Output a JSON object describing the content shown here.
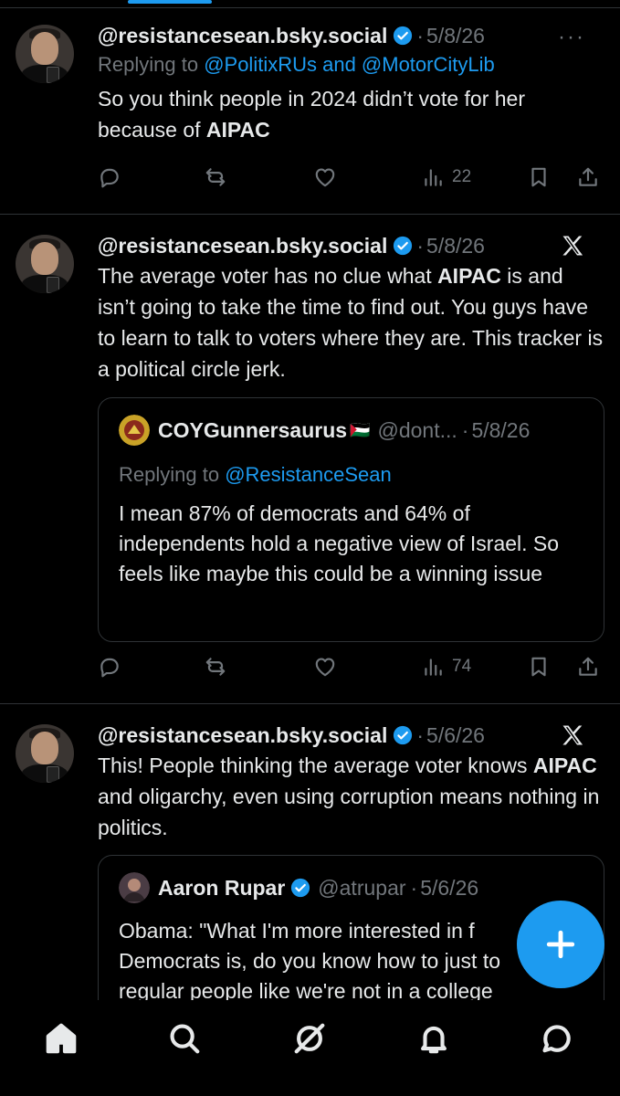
{
  "posts": [
    {
      "handle": "@resistancesean.bsky.social",
      "dot": "·",
      "date": "5/8/26",
      "more": "···",
      "replying_prefix": "Replying to ",
      "replying_handles": "@PolitixRUs and @MotorCityLib",
      "text_1": "So you think people in 2024 didn’t vote for her because of ",
      "text_bold": "AIPAC",
      "views": "22"
    },
    {
      "handle": "@resistancesean.bsky.social",
      "dot": "·",
      "date": "5/8/26",
      "text_1": "The average voter has no clue what ",
      "text_bold": "AIPAC",
      "text_2": " is and isn’t going to take the time to find out. You guys have to learn to talk to voters where they are. This tracker is a political circle jerk.",
      "quote": {
        "name": "COYGunnersaurus",
        "flag": "🇵🇸",
        "handle": "@dont...",
        "dot": "·",
        "date": "5/8/26",
        "replying_prefix": "Replying to ",
        "replying_handle": "@ResistanceSean",
        "text": "I mean 87% of democrats and 64% of independents hold a negative view of Israel. So feels like maybe this could be a winning issue"
      },
      "views": "74"
    },
    {
      "handle": "@resistancesean.bsky.social",
      "dot": "·",
      "date": "5/6/26",
      "text_1": "This! People thinking the average voter knows ",
      "text_bold": "AIPAC",
      "text_2": " and oligarchy, even using corruption means nothing in politics.",
      "quote": {
        "name": "Aaron Rupar",
        "handle": "@atrupar",
        "dot": "·",
        "date": "5/6/26",
        "text": "Obama: \"What I'm more interested in f Democrats is, do you know how to just to regular people like we're not in a college"
      }
    }
  ],
  "colors": {
    "accent": "#1d9bf0",
    "muted": "#71767b",
    "text": "#e7e9ea",
    "background": "#000000"
  },
  "icons": [
    "reply-icon",
    "repost-icon",
    "like-icon",
    "views-icon",
    "bookmark-icon",
    "share-icon",
    "x-logo-icon",
    "compose-icon",
    "home-icon",
    "search-icon",
    "grok-icon",
    "notifications-icon",
    "messages-icon"
  ]
}
